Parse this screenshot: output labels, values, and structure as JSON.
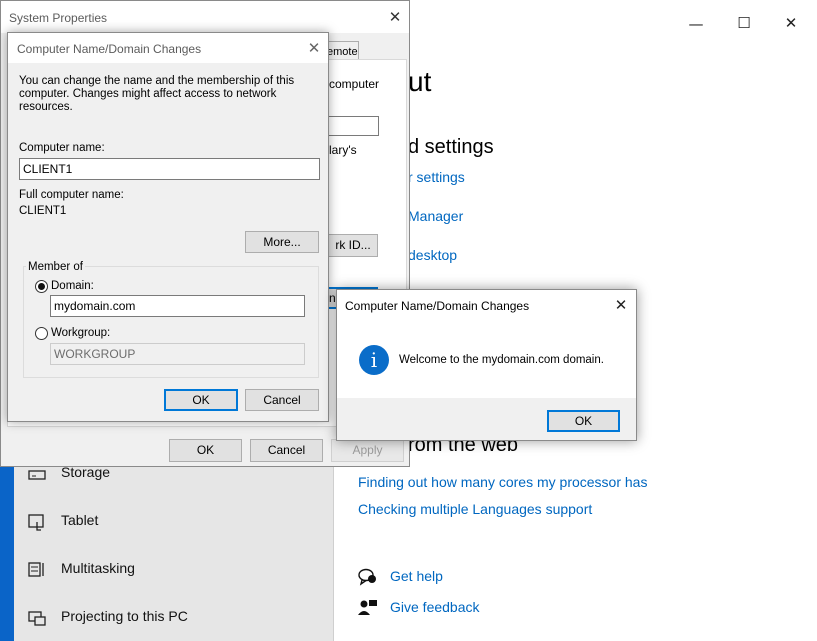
{
  "settings": {
    "controls": {
      "minimize": "—",
      "maximize": "☐",
      "close": "✕"
    },
    "heading_fragment": "ut",
    "related_fragment": "d settings",
    "related_links": [
      "r settings",
      "Manager",
      "desktop"
    ],
    "web_heading_fragment": "rom the web",
    "web_links": [
      "Finding out how many cores my processor has",
      "Checking multiple Languages support"
    ],
    "help_links": [
      "Get help",
      "Give feedback"
    ],
    "sidebar": [
      {
        "label": "Storage",
        "icon": "storage-icon"
      },
      {
        "label": "Tablet",
        "icon": "tablet-icon"
      },
      {
        "label": "Multitasking",
        "icon": "multitasking-icon"
      },
      {
        "label": "Projecting to this PC",
        "icon": "projector-icon"
      }
    ]
  },
  "system_properties": {
    "title": "System Properties",
    "close": "✕",
    "tab_partial": "emote",
    "fragments": [
      "computer",
      "lary's",
      "rk ID...",
      "n"
    ],
    "ok": "OK",
    "cancel": "Cancel",
    "apply": "Apply"
  },
  "computer_name_dialog": {
    "title": "Computer Name/Domain Changes",
    "close": "✕",
    "intro": "You can change the name and the membership of this computer. Changes might affect access to network resources.",
    "computer_name_label": "Computer name:",
    "computer_name_value": "CLIENT1",
    "full_name_label": "Full computer name:",
    "full_name_value": "CLIENT1",
    "more_button": "More...",
    "member_of_label": "Member of",
    "domain_label": "Domain:",
    "domain_value": "mydomain.com",
    "workgroup_label": "Workgroup:",
    "workgroup_value": "WORKGROUP",
    "selected_membership": "domain",
    "ok": "OK",
    "cancel": "Cancel"
  },
  "welcome_box": {
    "title": "Computer Name/Domain Changes",
    "close": "✕",
    "info_glyph": "i",
    "message": "Welcome to the mydomain.com domain.",
    "ok": "OK"
  },
  "colors": {
    "accent": "#0078d7",
    "link": "#0067c0",
    "desktop": "#0a64c8"
  }
}
